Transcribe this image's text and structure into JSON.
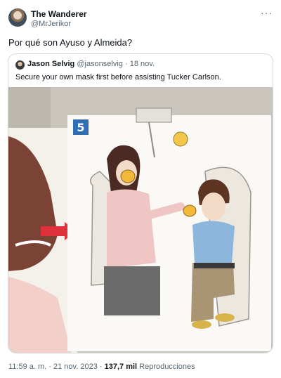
{
  "author": {
    "name": "The Wanderer",
    "handle": "@MrJerikor"
  },
  "tweet": {
    "text": "Por qué son Ayuso y Almeida?"
  },
  "quote": {
    "name": "Jason Selvig",
    "handle": "@jasonselvig",
    "separator": "·",
    "date": "18 nov.",
    "text": "Secure your own mask first before assisting Tucker Carlson.",
    "image": {
      "panel_number": "5"
    }
  },
  "footer": {
    "time": "11:59 a. m.",
    "separator": "·",
    "date": "21 nov. 2023",
    "separator2": "·",
    "views": "137,7 mil",
    "views_label": "Reproducciones"
  },
  "icons": {
    "more": "more-horizontal-icon"
  }
}
